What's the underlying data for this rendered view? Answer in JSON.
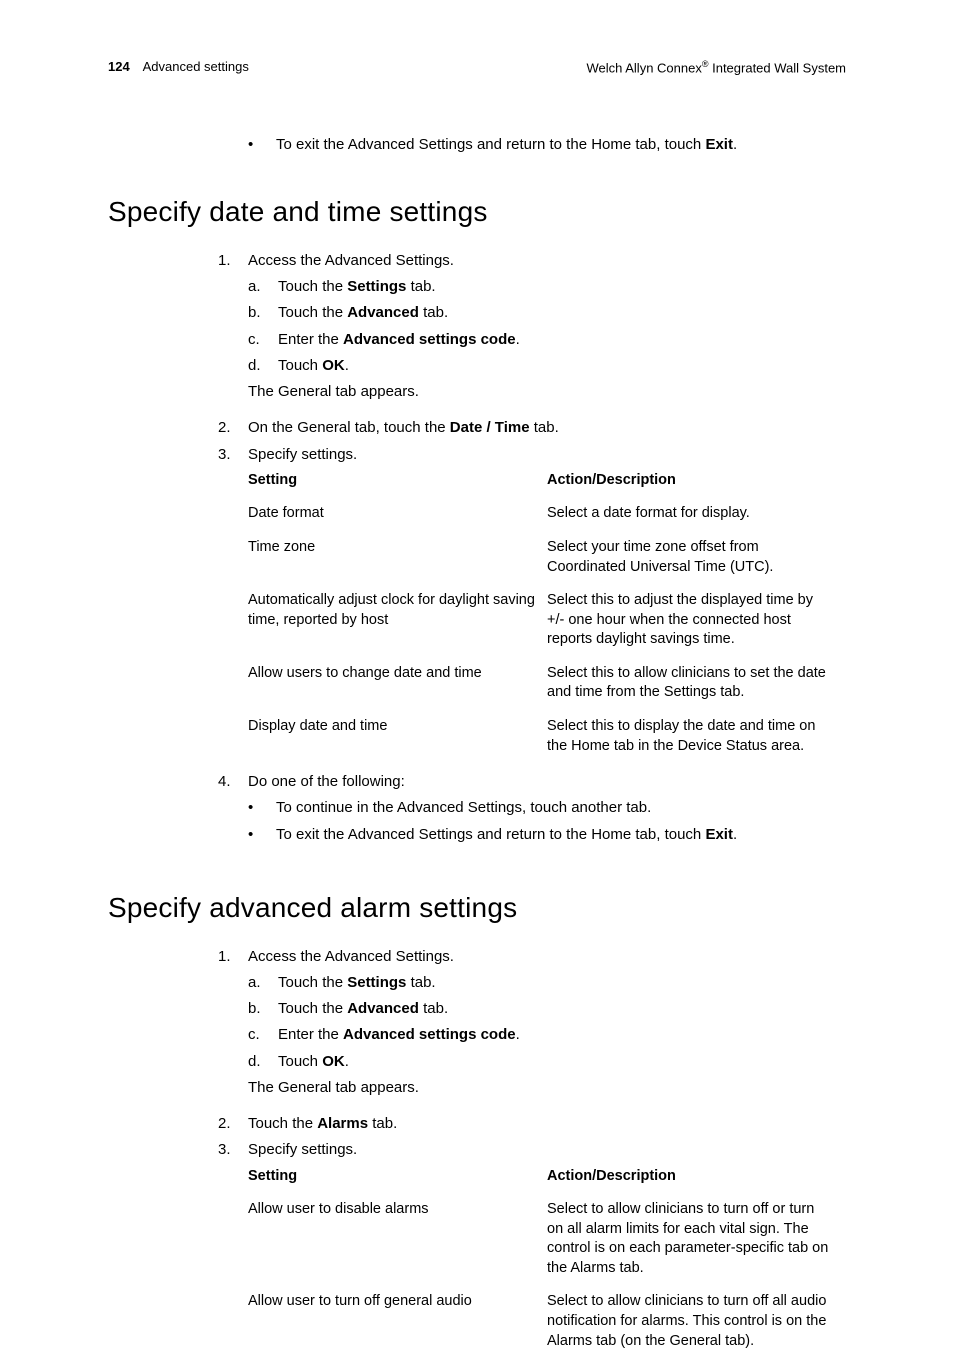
{
  "header": {
    "page_number": "124",
    "section": "Advanced settings",
    "product_prefix": "Welch Allyn Connex",
    "reg": "®",
    "product_suffix": " Integrated Wall System"
  },
  "top_bullet": {
    "prefix": "To exit the Advanced Settings and return to the Home tab, touch ",
    "bold": "Exit",
    "suffix": "."
  },
  "section1": {
    "title": "Specify date and time settings",
    "step1": {
      "text": "Access the Advanced Settings.",
      "a_pre": "Touch the ",
      "a_bold": "Settings",
      "a_post": " tab.",
      "b_pre": "Touch the ",
      "b_bold": "Advanced",
      "b_post": " tab.",
      "c_pre": "Enter the ",
      "c_bold": "Advanced settings code",
      "c_post": ".",
      "d_pre": "Touch ",
      "d_bold": "OK",
      "d_post": ".",
      "after": "The General tab appears."
    },
    "step2": {
      "pre": "On the General tab, touch the ",
      "bold": "Date / Time",
      "post": " tab."
    },
    "step3": {
      "text": "Specify settings.",
      "th1": "Setting",
      "th2": "Action/Description",
      "rows": [
        {
          "s": "Date format",
          "a": "Select a date format for display."
        },
        {
          "s": "Time zone",
          "a": "Select your time zone offset from Coordinated Universal Time (UTC)."
        },
        {
          "s": "Automatically adjust clock for daylight saving time, reported by host",
          "a": "Select this to adjust the displayed time by +/- one hour when the connected host reports daylight savings time."
        },
        {
          "s": "Allow users to change date and time",
          "a": "Select this to allow clinicians to set the date and time from the Settings tab."
        },
        {
          "s": "Display date and time",
          "a": "Select this to display the date and time on the Home tab in the Device Status area."
        }
      ]
    },
    "step4": {
      "text": "Do one of the following:",
      "b1": "To continue in the Advanced Settings, touch another tab.",
      "b2_pre": "To exit the Advanced Settings and return to the Home tab, touch ",
      "b2_bold": "Exit",
      "b2_post": "."
    }
  },
  "section2": {
    "title": "Specify advanced alarm settings",
    "step1": {
      "text": "Access the Advanced Settings.",
      "a_pre": "Touch the ",
      "a_bold": "Settings",
      "a_post": " tab.",
      "b_pre": "Touch the ",
      "b_bold": "Advanced",
      "b_post": " tab.",
      "c_pre": "Enter the ",
      "c_bold": "Advanced settings code",
      "c_post": ".",
      "d_pre": "Touch ",
      "d_bold": "OK",
      "d_post": ".",
      "after": "The General tab appears."
    },
    "step2": {
      "pre": "Touch the ",
      "bold": "Alarms",
      "post": " tab."
    },
    "step3": {
      "text": "Specify settings.",
      "th1": "Setting",
      "th2": "Action/Description",
      "rows": [
        {
          "s": "Allow user to disable alarms",
          "a": "Select to allow clinicians to turn off or turn on all alarm limits for each vital sign. The control is on each parameter-specific tab on the Alarms tab."
        },
        {
          "s": "Allow user to turn off general audio",
          "a": "Select to allow clinicians to turn off all audio notification for alarms. This control is on the Alarms tab (on the General tab)."
        }
      ]
    }
  }
}
